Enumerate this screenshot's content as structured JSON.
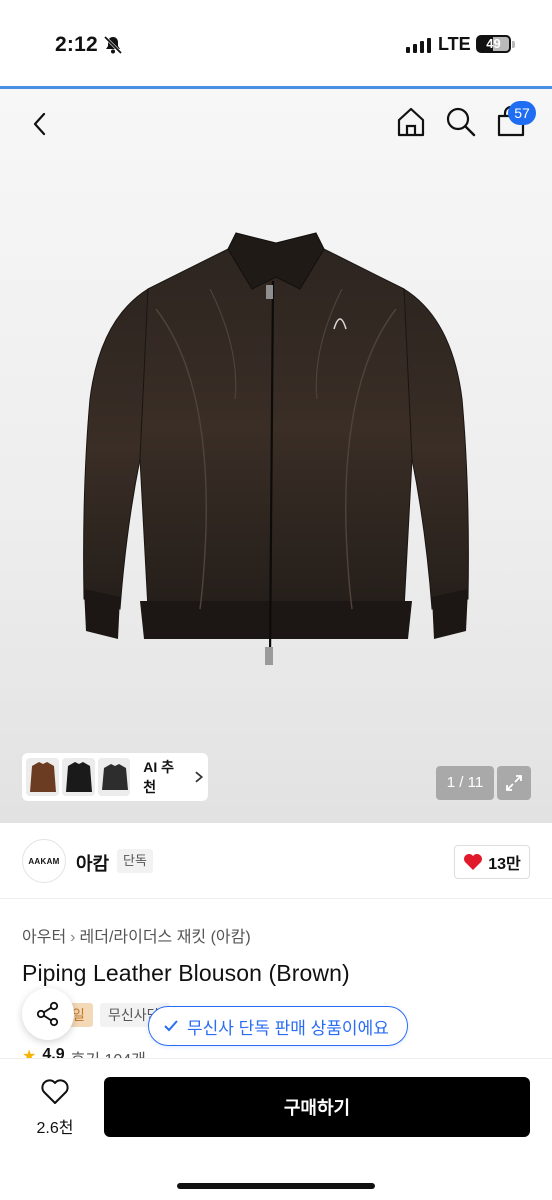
{
  "status": {
    "time": "2:12",
    "network": "LTE",
    "battery": "49",
    "battery_level": 0.49
  },
  "nav": {
    "cart_count": "57"
  },
  "gallery": {
    "pager": "1 / 11",
    "ai_label": "AI 추천",
    "thumb_colors": [
      "#6b3c22",
      "#1a1a1a",
      "#2d2d2d"
    ]
  },
  "brand": {
    "logo_text": "AAKAM",
    "name": "아캄",
    "tag": "단독",
    "likes": "13만"
  },
  "breadcrumb": {
    "cat1": "아우터",
    "cat2": "레더/라이더스 재킷 (아캄)"
  },
  "product": {
    "title": "Piping Leather Blouson (Brown)",
    "chip_sale": "일",
    "chip_grey": "무신사단독",
    "rating": "4.9",
    "reviews": "후기 104개"
  },
  "toast": {
    "text": "무신사 단독 판매 상품이에요"
  },
  "bottom": {
    "wish_count": "2.6천",
    "buy_label": "구매하기"
  },
  "colors": {
    "accent": "#2b6cf5",
    "heart": "#e0192b",
    "badge": "#1f6df2"
  }
}
